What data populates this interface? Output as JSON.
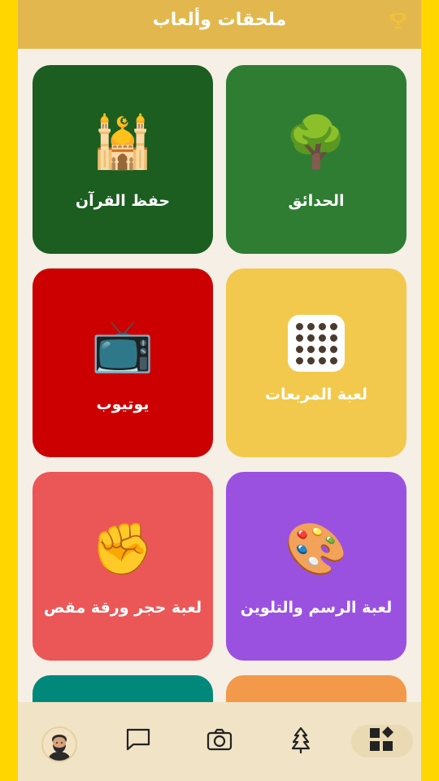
{
  "header": {
    "title": "ملحقات وألعاب",
    "trophy_icon": "trophy-icon"
  },
  "tiles": [
    {
      "label": "الحدائق",
      "icon": "tree-icon",
      "emoji": "🌳",
      "color": "#2E7D32"
    },
    {
      "label": "حفظ القرآن",
      "icon": "mosque-icon",
      "emoji": "🕌",
      "color": "#1B5E20"
    },
    {
      "label": "لعبة المربعات",
      "icon": "dots-grid-icon",
      "emoji": "",
      "color": "#F2C94C"
    },
    {
      "label": "يوتيوب",
      "icon": "television-icon",
      "emoji": "📺",
      "color": "#CC0000"
    },
    {
      "label": "لعبة الرسم والتلوين",
      "icon": "palette-icon",
      "emoji": "🎨",
      "color": "#9B51E0"
    },
    {
      "label": "لعبة حجر ورقة مقص",
      "icon": "raised-fist-icon",
      "emoji": "✊",
      "color": "#EB5757"
    },
    {
      "label": "",
      "icon": "",
      "emoji": "",
      "color": "#F2994A"
    },
    {
      "label": "",
      "icon": "",
      "emoji": "",
      "color": "#00897B"
    }
  ],
  "nav": {
    "items": [
      "apps-icon",
      "tree-icon",
      "camera-icon",
      "chat-icon",
      "avatar"
    ],
    "active": "apps-icon"
  },
  "colors": {
    "outer_border": "#FFD600",
    "header": "#E2B84E",
    "page_bg": "#F5EFE6",
    "nav_bg": "#F0E3C6"
  }
}
